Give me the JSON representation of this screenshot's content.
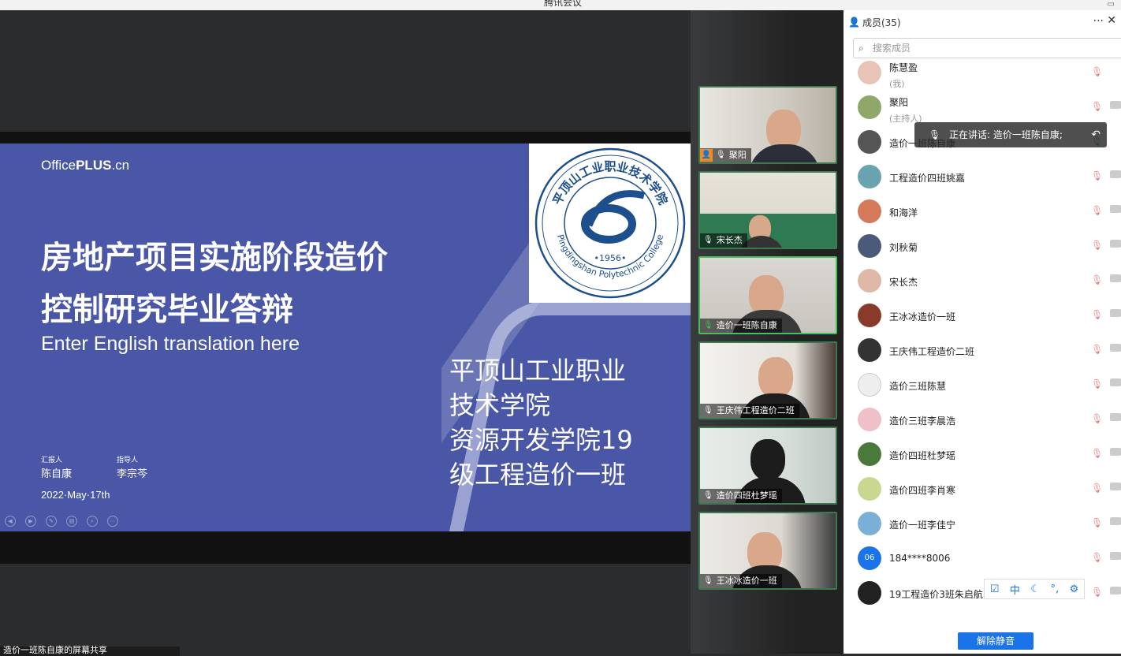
{
  "window": {
    "title": "腾讯会议"
  },
  "slide": {
    "brand_a": "Office",
    "brand_b": "PLUS",
    "brand_c": ".cn",
    "title_line1": "房地产项目实施阶段造价",
    "title_line2": "控制研究毕业答辩",
    "subtitle": "Enter English translation here",
    "school_lines": [
      "平顶山工业职业",
      "技术学院",
      "资源开发学院19",
      "级工程造价一班"
    ],
    "reporter_label": "汇报人",
    "reporter": "陈自康",
    "advisor_label": "指导人",
    "advisor": "李宗芩",
    "date": "2022·May·17th",
    "seal_text_top": "平顶山工业职业技术学院",
    "seal_text_bottom": "Pingdingshan Polytechnic College",
    "seal_year": "•1956•"
  },
  "share_status": "造价一班陈自康的屏幕共享",
  "videos": [
    {
      "name": "聚阳",
      "host": true,
      "mic_on": false
    },
    {
      "name": "宋长杰",
      "host": false,
      "mic_on": false
    },
    {
      "name": "造价一班陈自康",
      "host": false,
      "mic_on": true
    },
    {
      "name": "王庆伟工程造价二班",
      "host": false,
      "mic_on": false
    },
    {
      "name": "造价四班杜梦瑶",
      "host": false,
      "mic_on": false
    },
    {
      "name": "王冰冰造价一班",
      "host": false,
      "mic_on": false
    }
  ],
  "panel": {
    "header": "成员(35)",
    "more": "···",
    "close": "✕",
    "search_placeholder": "搜索成员",
    "speaking_tip": "正在讲话: 造价一班陈自康;",
    "unmute_button": "解除静音",
    "members": [
      {
        "name": "陈慧盈",
        "sub": "(我)",
        "avatar_color": "#e8c4b8"
      },
      {
        "name": "聚阳",
        "sub": "(主持人)",
        "avatar_color": "#8fa86a"
      },
      {
        "name": "造价一班陈自康",
        "sub": "",
        "avatar_color": "#555"
      },
      {
        "name": "工程造价四班姚嘉",
        "sub": "",
        "avatar_color": "#6aa3b0"
      },
      {
        "name": "和海洋",
        "sub": "",
        "avatar_color": "#d47a5a"
      },
      {
        "name": "刘秋菊",
        "sub": "",
        "avatar_color": "#4a5a7a"
      },
      {
        "name": "宋长杰",
        "sub": "",
        "avatar_color": "#e0b8a8"
      },
      {
        "name": "王冰冰造价一班",
        "sub": "",
        "avatar_color": "#8a3a2a"
      },
      {
        "name": "王庆伟工程造价二班",
        "sub": "",
        "avatar_color": "#333"
      },
      {
        "name": "造价三班陈慧",
        "sub": "",
        "avatar_color": "#eee"
      },
      {
        "name": "造价三班李晨浩",
        "sub": "",
        "avatar_color": "#f0c0c8"
      },
      {
        "name": "造价四班杜梦瑶",
        "sub": "",
        "avatar_color": "#4a7a3a"
      },
      {
        "name": "造价四班李肖寒",
        "sub": "",
        "avatar_color": "#c8d890"
      },
      {
        "name": "造价一班李佳宁",
        "sub": "",
        "avatar_color": "#7ab0d8"
      },
      {
        "name": "184****8006",
        "sub": "",
        "avatar_color": "#1a73e8",
        "avatar_text": "06"
      },
      {
        "name": "19工程造价3班朱启航",
        "sub": "",
        "avatar_color": "#222"
      }
    ]
  },
  "ime": {
    "items": [
      "中"
    ]
  }
}
